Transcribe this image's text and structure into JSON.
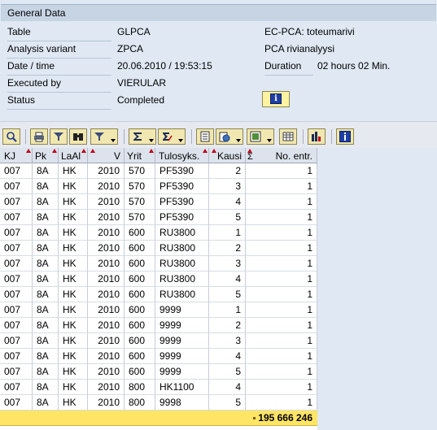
{
  "general": {
    "tab_title": "General Data",
    "fields": {
      "table_label": "Table",
      "table_value": "GLPCA",
      "variant_label": "Analysis variant",
      "variant_value": "ZPCA",
      "datetime_label": "Date / time",
      "datetime_value": "20.06.2010 / 19:53:15",
      "executed_label": "Executed by",
      "executed_value": "VIERULAR",
      "status_label": "Status",
      "status_value": "Completed"
    },
    "right": {
      "table_desc": "EC-PCA: toteumarivi",
      "variant_desc": "PCA rivianalyysi",
      "duration_label": "Duration",
      "duration_value": "02 hours 02 Min."
    },
    "info_button_icon": "i"
  },
  "toolbar": {
    "icons": [
      "details-icon",
      "print-icon",
      "filter-icon",
      "find-icon",
      "filter-dropdown-icon",
      "sum-icon",
      "subtotal-icon",
      "print-preview-icon",
      "export-icon",
      "spreadsheet-icon",
      "layout-icon",
      "grid-icon",
      "abc-analysis-icon",
      "info-icon"
    ]
  },
  "table": {
    "columns": [
      "KJ",
      "Pk",
      "LaAl",
      "V",
      "Yrit",
      "Tulosyks.",
      "Kausi",
      "Σ",
      "No. entr."
    ],
    "rows": [
      [
        "007",
        "8A",
        "HK",
        "2010",
        "570",
        "PF5390",
        "2",
        "1"
      ],
      [
        "007",
        "8A",
        "HK",
        "2010",
        "570",
        "PF5390",
        "3",
        "1"
      ],
      [
        "007",
        "8A",
        "HK",
        "2010",
        "570",
        "PF5390",
        "4",
        "1"
      ],
      [
        "007",
        "8A",
        "HK",
        "2010",
        "570",
        "PF5390",
        "5",
        "1"
      ],
      [
        "007",
        "8A",
        "HK",
        "2010",
        "600",
        "RU3800",
        "1",
        "1"
      ],
      [
        "007",
        "8A",
        "HK",
        "2010",
        "600",
        "RU3800",
        "2",
        "1"
      ],
      [
        "007",
        "8A",
        "HK",
        "2010",
        "600",
        "RU3800",
        "3",
        "1"
      ],
      [
        "007",
        "8A",
        "HK",
        "2010",
        "600",
        "RU3800",
        "4",
        "1"
      ],
      [
        "007",
        "8A",
        "HK",
        "2010",
        "600",
        "RU3800",
        "5",
        "1"
      ],
      [
        "007",
        "8A",
        "HK",
        "2010",
        "600",
        "9999",
        "1",
        "1"
      ],
      [
        "007",
        "8A",
        "HK",
        "2010",
        "600",
        "9999",
        "2",
        "1"
      ],
      [
        "007",
        "8A",
        "HK",
        "2010",
        "600",
        "9999",
        "3",
        "1"
      ],
      [
        "007",
        "8A",
        "HK",
        "2010",
        "600",
        "9999",
        "4",
        "1"
      ],
      [
        "007",
        "8A",
        "HK",
        "2010",
        "600",
        "9999",
        "5",
        "1"
      ],
      [
        "007",
        "8A",
        "HK",
        "2010",
        "800",
        "HK1100",
        "4",
        "1"
      ],
      [
        "007",
        "8A",
        "HK",
        "2010",
        "800",
        "9998",
        "5",
        "1"
      ]
    ],
    "total": "195 666 246"
  },
  "colors": {
    "panel_bg": "#dfe8f3",
    "total_row": "#ffe566",
    "sort_marker": "#c2001b"
  }
}
